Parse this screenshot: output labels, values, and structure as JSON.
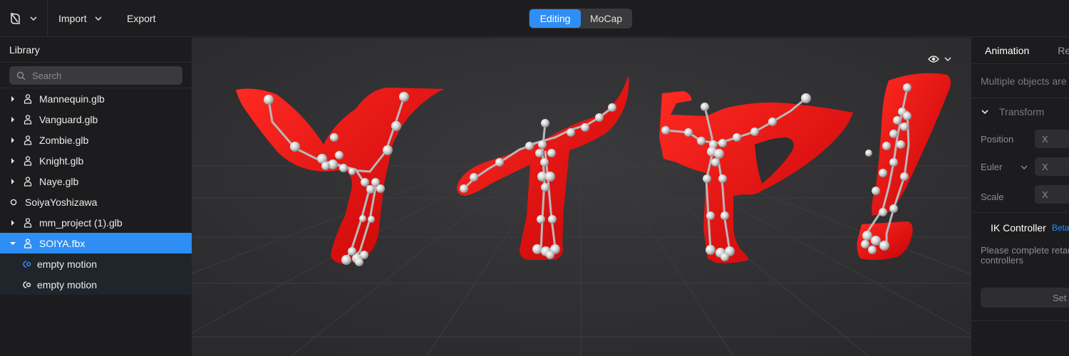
{
  "topbar": {
    "logo_icon": "leaf-icon",
    "import_label": "Import",
    "export_label": "Export",
    "modes": {
      "editing": "Editing",
      "mocap": "MoCap",
      "active": "Editing"
    },
    "accent": "#2f8ef4"
  },
  "library": {
    "title": "Library",
    "search_placeholder": "Search",
    "items": [
      {
        "label": "Mannequin.glb",
        "icon": "person-icon",
        "expandable": true
      },
      {
        "label": "Vanguard.glb",
        "icon": "person-icon",
        "expandable": true
      },
      {
        "label": "Zombie.glb",
        "icon": "person-icon",
        "expandable": true
      },
      {
        "label": "Knight.glb",
        "icon": "person-icon",
        "expandable": true
      },
      {
        "label": "Naye.glb",
        "icon": "person-icon",
        "expandable": true
      },
      {
        "label": "SoiyaYoshizawa",
        "icon": "circle-icon",
        "expandable": false
      },
      {
        "label": "mm_project (1).glb",
        "icon": "person-icon",
        "expandable": true
      },
      {
        "label": "SOIYA.fbx",
        "icon": "person-icon",
        "expandable": true,
        "selected": true,
        "expanded": true
      }
    ],
    "children": [
      {
        "label": "empty motion",
        "icon": "motion-icon",
        "active": true
      },
      {
        "label": "empty motion",
        "icon": "motion-icon",
        "active": false
      }
    ]
  },
  "viewport": {
    "view_icon": "eye-icon",
    "model_color": "#e0080a"
  },
  "right_panel": {
    "tabs": [
      {
        "label": "Animation",
        "active": true
      },
      {
        "label": "Retarget",
        "active": false
      }
    ],
    "note": "Multiple objects are selected",
    "transform": {
      "title": "Transform",
      "position_label": "Position",
      "euler_label": "Euler",
      "scale_label": "Scale",
      "axis_x": "X"
    },
    "ik": {
      "title": "IK Controller",
      "badge": "Beta",
      "message_line1": "Please complete retargeting to use IK",
      "message_line2": "controllers",
      "set_button": "Set"
    }
  }
}
